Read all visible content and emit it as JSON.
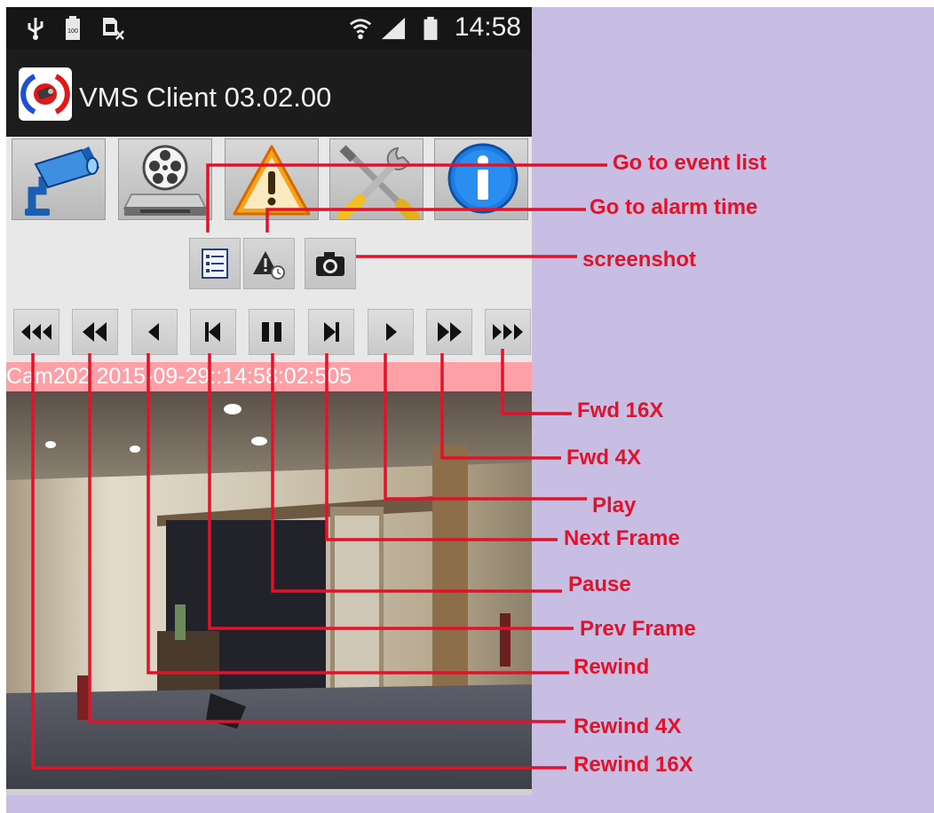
{
  "status_bar": {
    "time": "14:58",
    "icons": [
      "usb-icon",
      "battery-full-icon",
      "sim-card-missing-icon",
      "wifi-icon",
      "signal-strength-icon",
      "battery-icon"
    ]
  },
  "action_bar": {
    "title": "VMS Client 03.02.00",
    "logo": "vms-camera-logo"
  },
  "main_tabs": [
    {
      "name": "live-camera-tab",
      "icon": "security-camera-icon"
    },
    {
      "name": "playback-tab",
      "icon": "film-reel-storage-icon"
    },
    {
      "name": "alarm-tab",
      "icon": "warning-icon"
    },
    {
      "name": "settings-tab",
      "icon": "tools-icon"
    },
    {
      "name": "info-tab",
      "icon": "info-icon"
    }
  ],
  "tools": [
    {
      "name": "event-list-button",
      "icon": "list-icon"
    },
    {
      "name": "alarm-time-button",
      "icon": "alarm-clock-warning-icon"
    },
    {
      "name": "screenshot-button",
      "icon": "camera-icon"
    }
  ],
  "playback_controls": [
    {
      "name": "rewind-16x-button",
      "icon": "triple-left-icon"
    },
    {
      "name": "rewind-4x-button",
      "icon": "double-left-icon"
    },
    {
      "name": "rewind-button",
      "icon": "single-left-icon"
    },
    {
      "name": "prev-frame-button",
      "icon": "step-back-icon"
    },
    {
      "name": "pause-button",
      "icon": "pause-icon"
    },
    {
      "name": "next-frame-button",
      "icon": "step-forward-icon"
    },
    {
      "name": "play-button",
      "icon": "play-icon"
    },
    {
      "name": "fwd-4x-button",
      "icon": "double-right-icon"
    },
    {
      "name": "fwd-16x-button",
      "icon": "triple-right-icon"
    }
  ],
  "camera_info": "Cam202 2015-09-29::14:58:02:505",
  "annotations": {
    "go_to_event_list": "Go to event list",
    "go_to_alarm_time": "Go to alarm time",
    "screenshot": "screenshot",
    "fwd_16x": "Fwd 16X",
    "fwd_4x": "Fwd 4X",
    "play": "Play",
    "next_frame": "Next Frame",
    "pause": "Pause",
    "prev_frame": "Prev Frame",
    "rewind": "Rewind",
    "rewind_4x": "Rewind 4X",
    "rewind_16x": "Rewind 16X"
  },
  "colors": {
    "annotation_red": "#e3122a",
    "background_lavender": "#c8bde2",
    "caminfo_pink": "#ffa0a6",
    "status_bar": "#161616"
  }
}
